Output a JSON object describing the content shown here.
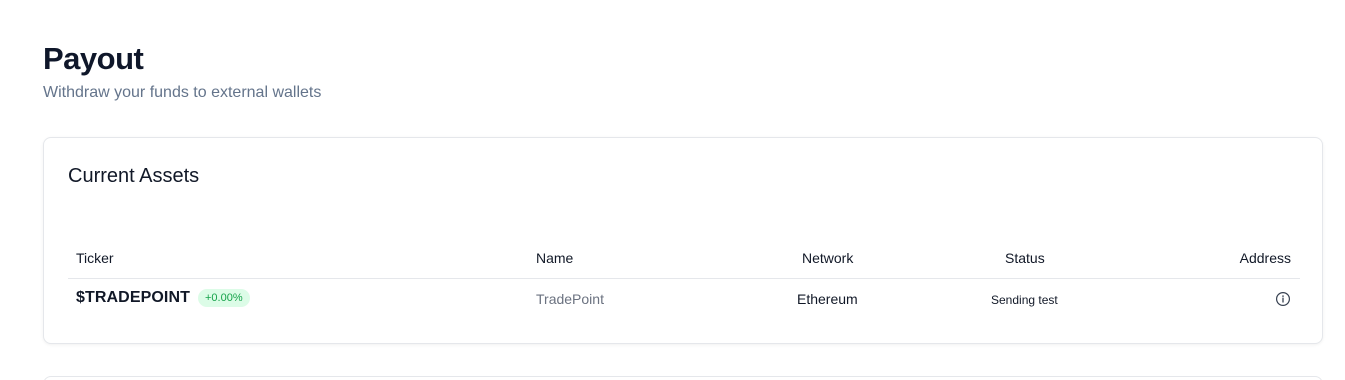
{
  "header": {
    "title": "Payout",
    "subtitle": "Withdraw your funds to external wallets"
  },
  "assets_card": {
    "title": "Current Assets",
    "columns": {
      "ticker": "Ticker",
      "name": "Name",
      "network": "Network",
      "status": "Status",
      "address": "Address"
    },
    "rows": [
      {
        "ticker": "$TRADEPOINT",
        "change": "+0.00%",
        "name": "TradePoint",
        "network": "Ethereum",
        "status": "Sending test",
        "address_icon": "info-icon"
      }
    ]
  },
  "colors": {
    "title": "#0f172a",
    "subtitle": "#64748b",
    "badge_text": "#16a34a",
    "badge_bg": "#dcfce7",
    "border": "#e5e7eb"
  }
}
